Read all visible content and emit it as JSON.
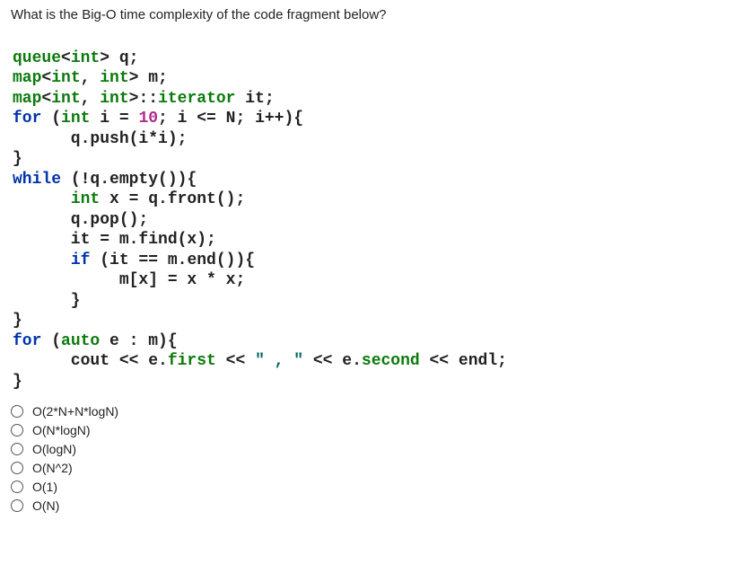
{
  "question": "What is the Big-O time complexity of the code fragment below?",
  "code": {
    "l1": {
      "a": "queue",
      "b": "<",
      "c": "int",
      "d": "> q;"
    },
    "l2": {
      "a": "map",
      "b": "<",
      "c": "int",
      "d": ", ",
      "e": "int",
      "f": "> m;"
    },
    "l3": {
      "a": "map",
      "b": "<",
      "c": "int",
      "d": ", ",
      "e": "int",
      "f": ">",
      "g": "::",
      "h": "iterator",
      "i": " it;"
    },
    "l4": {
      "a": "for",
      "b": " (",
      "c": "int",
      "d": " i = ",
      "e": "10",
      "f": "; i <= N; i++){"
    },
    "l5": {
      "a": "      q.push(i*i);"
    },
    "l6": {
      "a": "}"
    },
    "l7": {
      "a": "while",
      "b": " (!q.empty()){"
    },
    "l8": {
      "a": "      ",
      "b": "int",
      "c": " x = q.front();"
    },
    "l9": {
      "a": "      q.pop();"
    },
    "l10": {
      "a": "      it = m.find(x);"
    },
    "l11": {
      "a": "      ",
      "b": "if",
      "c": " (it == m.end()){"
    },
    "l12": {
      "a": "           m[x] = x * x;"
    },
    "l13": {
      "a": "      }"
    },
    "l14": {
      "a": "}"
    },
    "l15": {
      "a": "for",
      "b": " (",
      "c": "auto",
      "d": " e : m){"
    },
    "l16": {
      "a": "      cout << e.",
      "b": "first",
      "c": " << ",
      "d": "\" , \"",
      "e": " << e.",
      "f": "second",
      "g": " << endl;"
    },
    "l17": {
      "a": "}"
    }
  },
  "options": [
    {
      "label": "O(2*N+N*logN)"
    },
    {
      "label": "O(N*logN)"
    },
    {
      "label": "O(logN)"
    },
    {
      "label": "O(N^2)"
    },
    {
      "label": "O(1)"
    },
    {
      "label": "O(N)"
    }
  ]
}
